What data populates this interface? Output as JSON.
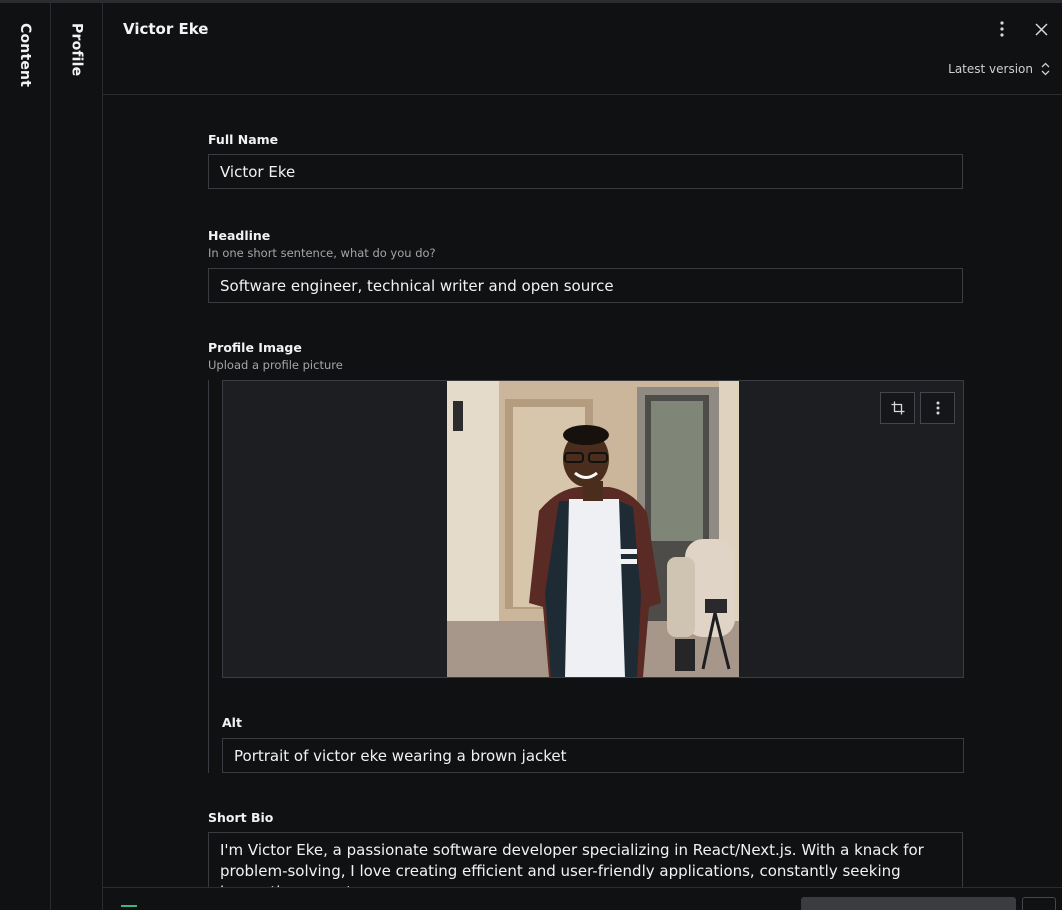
{
  "rails": {
    "content": "Content",
    "profile": "Profile"
  },
  "header": {
    "title": "Victor Eke",
    "version_label": "Latest version"
  },
  "fields": {
    "full_name": {
      "label": "Full Name",
      "value": "Victor Eke"
    },
    "headline": {
      "label": "Headline",
      "description": "In one short sentence, what do you do?",
      "value": "Software engineer, technical writer and open source"
    },
    "profile_image": {
      "label": "Profile Image",
      "description": "Upload a profile picture",
      "alt_label": "Alt",
      "alt_value": "Portrait of victor eke wearing a brown jacket"
    },
    "short_bio": {
      "label": "Short Bio",
      "value": "I'm Victor Eke, a passionate software developer specializing in React/Next.js. With a knack for problem-solving, I love creating efficient and user-friendly applications, constantly seeking innovative ways to"
    }
  },
  "icons": {
    "menu": "vertical-dots-icon",
    "close": "close-icon",
    "version": "chevron-up-down-icon",
    "crop": "crop-icon",
    "image_menu": "vertical-dots-icon"
  },
  "colors": {
    "background": "#101112",
    "border": "#3a3c42",
    "status": "#3fb47d"
  }
}
